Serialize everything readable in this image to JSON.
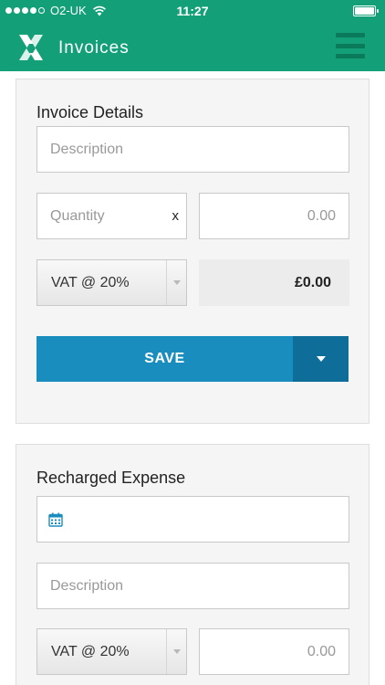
{
  "status_bar": {
    "carrier": "O2-UK",
    "time": "11:27"
  },
  "header": {
    "title": "Invoices"
  },
  "invoice_details": {
    "title": "Invoice Details",
    "description_placeholder": "Description",
    "quantity_placeholder": "Quantity",
    "multiply_symbol": "x",
    "price_placeholder": "0.00",
    "vat_label": "VAT @  20%",
    "total": "£0.00",
    "save_label": "SAVE"
  },
  "recharged_expense": {
    "title": "Recharged Expense",
    "description_placeholder": "Description",
    "vat_label": "VAT @  20%",
    "amount_placeholder": "0.00"
  }
}
